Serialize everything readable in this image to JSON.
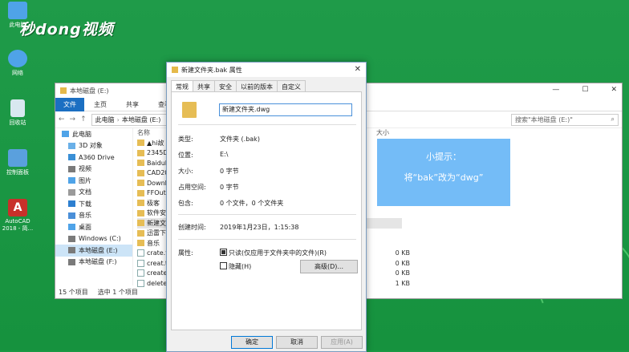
{
  "desktop": {
    "logo": "秒dong视频",
    "icons": [
      {
        "label": "此电脑",
        "color": "#4fa3e8"
      },
      {
        "label": "网络",
        "color": "#4fa3e8"
      },
      {
        "label": "回收站",
        "color": "#d8e8f0"
      },
      {
        "label": "控制面板",
        "color": "#5aa0dd"
      },
      {
        "label": "AutoCAD 2018 - 简...",
        "color": "#c8302a"
      }
    ]
  },
  "explorer": {
    "title": "本地磁盘 (E:)",
    "controls": {
      "minimize": "—",
      "maximize": "☐",
      "close": "✕"
    },
    "ribbon": [
      "文件",
      "主页",
      "共享",
      "查看"
    ],
    "nav_buttons": {
      "back": "←",
      "forward": "→",
      "up": "↑"
    },
    "path": [
      "此电脑",
      "本地磁盘 (E:)"
    ],
    "search_placeholder": "搜索\"本地磁盘 (E:)\"",
    "nav_pane": [
      {
        "label": "此电脑",
        "color": "#4fa3e8"
      },
      {
        "label": "3D 对象",
        "color": "#6ab0e8"
      },
      {
        "label": "A360 Drive",
        "color": "#3a8fd6"
      },
      {
        "label": "视频",
        "color": "#7a7a7a"
      },
      {
        "label": "图片",
        "color": "#4fa3e8"
      },
      {
        "label": "文档",
        "color": "#9a9a9a"
      },
      {
        "label": "下载",
        "color": "#2d7fd0"
      },
      {
        "label": "音乐",
        "color": "#4a8fd8"
      },
      {
        "label": "桌面",
        "color": "#4fa3e8"
      },
      {
        "label": "Windows (C:)",
        "color": "#7a7a7a"
      },
      {
        "label": "本地磁盘 (E:)",
        "color": "#7a7a7a"
      },
      {
        "label": "本地磁盘 (F:)",
        "color": "#7a7a7a"
      }
    ],
    "column_name": "名称",
    "column_size": "大小",
    "files": [
      {
        "name": "▲hi故",
        "kind": "folder",
        "size": ""
      },
      {
        "name": "2345Do",
        "kind": "folder",
        "size": ""
      },
      {
        "name": "BaiduN",
        "kind": "folder",
        "size": ""
      },
      {
        "name": "CAD20",
        "kind": "folder",
        "size": ""
      },
      {
        "name": "Downl",
        "kind": "folder",
        "size": ""
      },
      {
        "name": "FFOutp",
        "kind": "folder",
        "size": ""
      },
      {
        "name": "极客",
        "kind": "folder",
        "size": ""
      },
      {
        "name": "软件安",
        "kind": "folder",
        "size": ""
      },
      {
        "name": "新建文",
        "kind": "folder",
        "size": ""
      },
      {
        "name": "迅雷下",
        "kind": "folder",
        "size": ""
      },
      {
        "name": "音乐",
        "kind": "folder",
        "size": ""
      },
      {
        "name": "crate.tx",
        "kind": "doc",
        "size": "0 KB"
      },
      {
        "name": "creat.tx",
        "kind": "doc",
        "size": "0 KB"
      },
      {
        "name": "create.",
        "kind": "doc",
        "size": "0 KB"
      },
      {
        "name": "delete5",
        "kind": "doc",
        "size": "1 KB"
      }
    ],
    "status_count": "15 个项目",
    "status_selected": "选中 1 个项目"
  },
  "tip": {
    "line1": "小提示：",
    "line2": "将“bak”改为“dwg”"
  },
  "dialog": {
    "title": "新建文件夹.bak 属性",
    "close": "✕",
    "tabs": [
      "常规",
      "共享",
      "安全",
      "以前的版本",
      "自定义"
    ],
    "name_value": "新建文件夹.dwg",
    "type_label": "类型:",
    "type_value": "文件夹 (.bak)",
    "location_label": "位置:",
    "location_value": "E:\\",
    "size_label": "大小:",
    "size_value": "0 字节",
    "disk_label": "占用空间:",
    "disk_value": "0 字节",
    "contains_label": "包含:",
    "contains_value": "0 个文件，0 个文件夹",
    "created_label": "创建时间:",
    "created_value": "2019年1月23日，1:15:38",
    "attr_label": "属性:",
    "readonly_label": "只读(仅应用于文件夹中的文件)(R)",
    "hidden_label": "隐藏(H)",
    "advanced_label": "高级(D)...",
    "ok_label": "确定",
    "cancel_label": "取消",
    "apply_label": "应用(A)"
  }
}
